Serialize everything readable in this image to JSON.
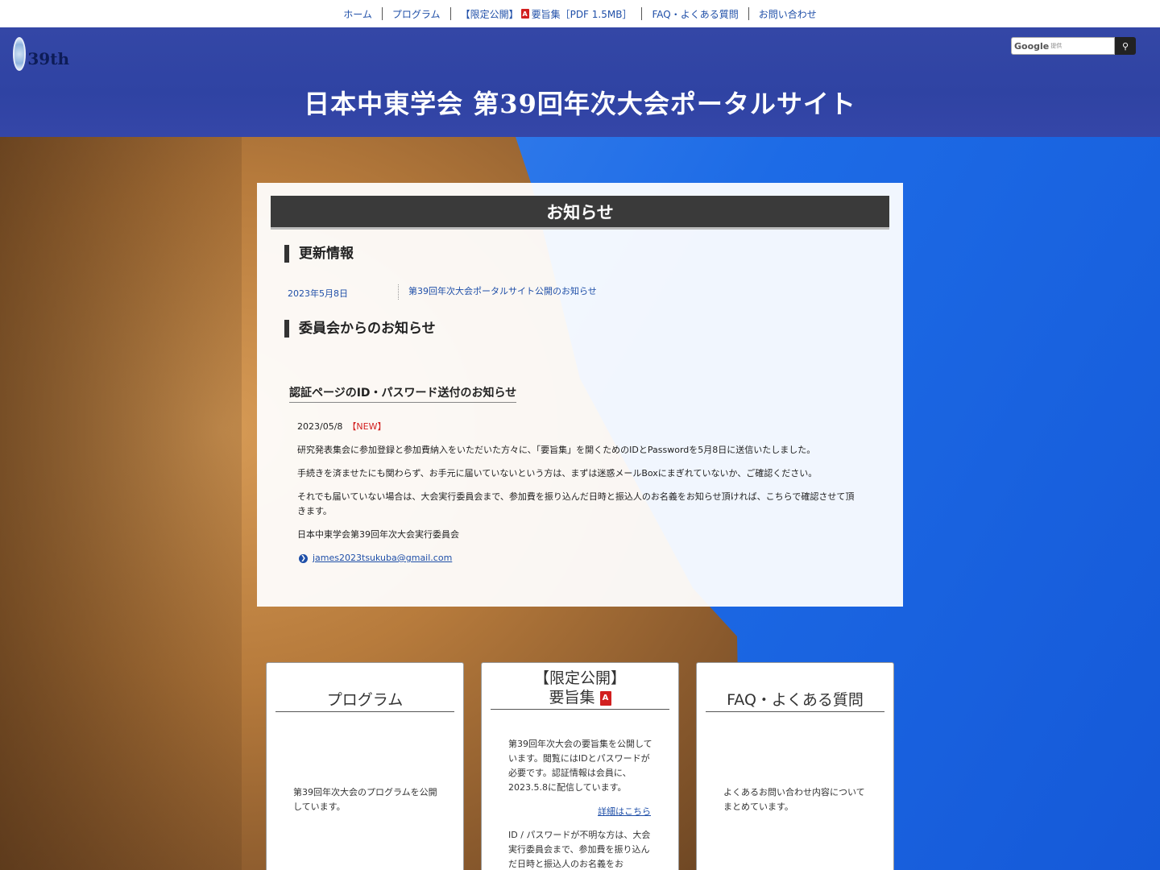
{
  "topnav": {
    "items": [
      {
        "label": "ホーム"
      },
      {
        "label": "プログラム"
      },
      {
        "label_pre": "【限定公開】",
        "label_post": "要旨集［PDF 1.5MB］"
      },
      {
        "label": "FAQ・よくある質問"
      },
      {
        "label": "お問い合わせ"
      }
    ]
  },
  "header": {
    "logo_text": "39th",
    "title": "日本中東学会  第39回年次大会ポータルサイト",
    "search_google": "Google",
    "search_provider": "提供"
  },
  "panel": {
    "title": "お知らせ",
    "updates_heading": "更新情報",
    "news": [
      {
        "date": "2023年5月8日",
        "text": "第39回年次大会ポータルサイト公開のお知らせ"
      }
    ],
    "committee_heading": "委員会からのお知らせ",
    "notice": {
      "title": "認証ページのID・パスワード送付のお知らせ",
      "date": "2023/05/8",
      "badge": "【NEW】",
      "p1": "研究発表集会に参加登録と参加費納入をいただいた方々に、「要旨集」を開くためのIDとPasswordを5月8日に送信いたしました。",
      "p2": "手続きを済ませたにも関わらず、お手元に届いていないという方は、まずは迷惑メールBoxにまぎれていないか、ご確認ください。",
      "p3": "それでも届いていない場合は、大会実行委員会まで、参加費を振り込んだ日時と振込人のお名義をお知らせ頂ければ、こちらで確認させて頂きます。",
      "signature": "日本中東学会第39回年次大会実行委員会",
      "email": "james2023tsukuba@gmail.com"
    }
  },
  "cards": {
    "program": {
      "title": "プログラム",
      "text": "第39回年次大会のプログラムを公開しています。"
    },
    "abstracts": {
      "title_line1": "【限定公開】",
      "title_line2": "要旨集",
      "text": "第39回年次大会の要旨集を公開しています。閲覧にはIDとパスワードが必要です。認証情報は会員に、2023.5.8に配信しています。",
      "more": "詳細はこちら",
      "text2": "ID / パスワードが不明な方は、大会実行委員会まで、参加費を振り込んだ日時と振込人のお名義をお"
    },
    "faq": {
      "title": "FAQ・よくある質問",
      "text": "よくあるお問い合わせ内容についてまとめています。"
    }
  },
  "colors": {
    "header_blue": "#2f43a3",
    "link_blue": "#1f4fa8",
    "new_red": "#d21f1f",
    "panel_title_bg": "#3a3a3a"
  },
  "icons": [
    "pdf-icon",
    "search-icon",
    "arrow-circle-icon"
  ]
}
